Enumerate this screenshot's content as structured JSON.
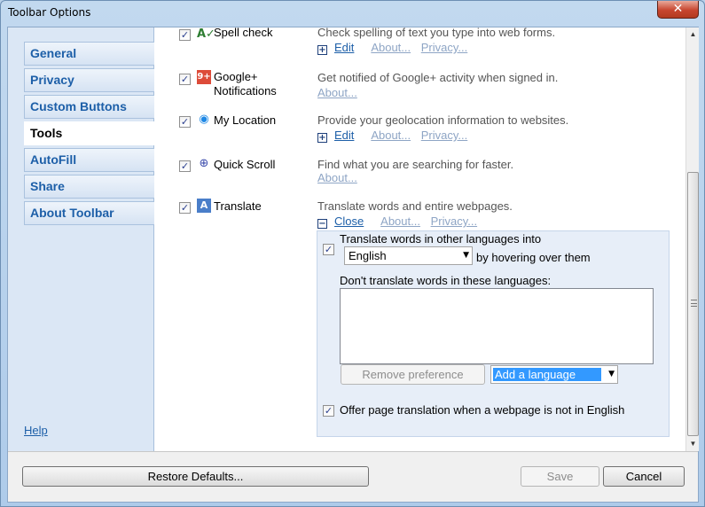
{
  "window": {
    "title": "Toolbar Options",
    "close_glyph": "✕"
  },
  "sidebar": {
    "items": [
      {
        "label": "General"
      },
      {
        "label": "Privacy"
      },
      {
        "label": "Custom Buttons"
      },
      {
        "label": "Tools"
      },
      {
        "label": "AutoFill"
      },
      {
        "label": "Share"
      },
      {
        "label": "About Toolbar"
      }
    ],
    "active_index": 3,
    "help_label": "Help"
  },
  "tools": [
    {
      "name": "Spell check",
      "icon": "spell-check-icon",
      "checked": true,
      "description": "Check spelling of text you type into web forms.",
      "links": [
        "Edit",
        "About...",
        "Privacy..."
      ]
    },
    {
      "name_line1": "Google+",
      "name_line2": "Notifications",
      "icon": "google-plus-icon",
      "icon_text": "9+",
      "checked": true,
      "description": "Get notified of Google+ activity when signed in.",
      "links": [
        "About..."
      ]
    },
    {
      "name": "My Location",
      "icon": "wifi-location-icon",
      "checked": true,
      "description": "Provide your geolocation information to websites.",
      "links": [
        "Edit",
        "About...",
        "Privacy..."
      ]
    },
    {
      "name": "Quick Scroll",
      "icon": "quick-scroll-icon",
      "checked": true,
      "description": "Find what you are searching for faster.",
      "links": [
        "About..."
      ]
    },
    {
      "name": "Translate",
      "icon": "translate-icon",
      "checked": true,
      "description": "Translate words and entire webpages.",
      "links": [
        "Close",
        "About...",
        "Privacy..."
      ]
    }
  ],
  "translate_panel": {
    "translate_words_label": "Translate words in other languages into",
    "target_language": "English",
    "hover_suffix": "by hovering over them",
    "dont_translate_label": "Don't translate words in these languages:",
    "remove_button": "Remove preference",
    "add_language": "Add a language",
    "offer_translation_label": "Offer page translation when a webpage is not in English"
  },
  "footer": {
    "restore_button": "Restore Defaults...",
    "save_button": "Save",
    "cancel_button": "Cancel"
  },
  "colors": {
    "link": "#1d5fa8",
    "selection": "#3399ff",
    "google_plus": "#dd4b39"
  }
}
